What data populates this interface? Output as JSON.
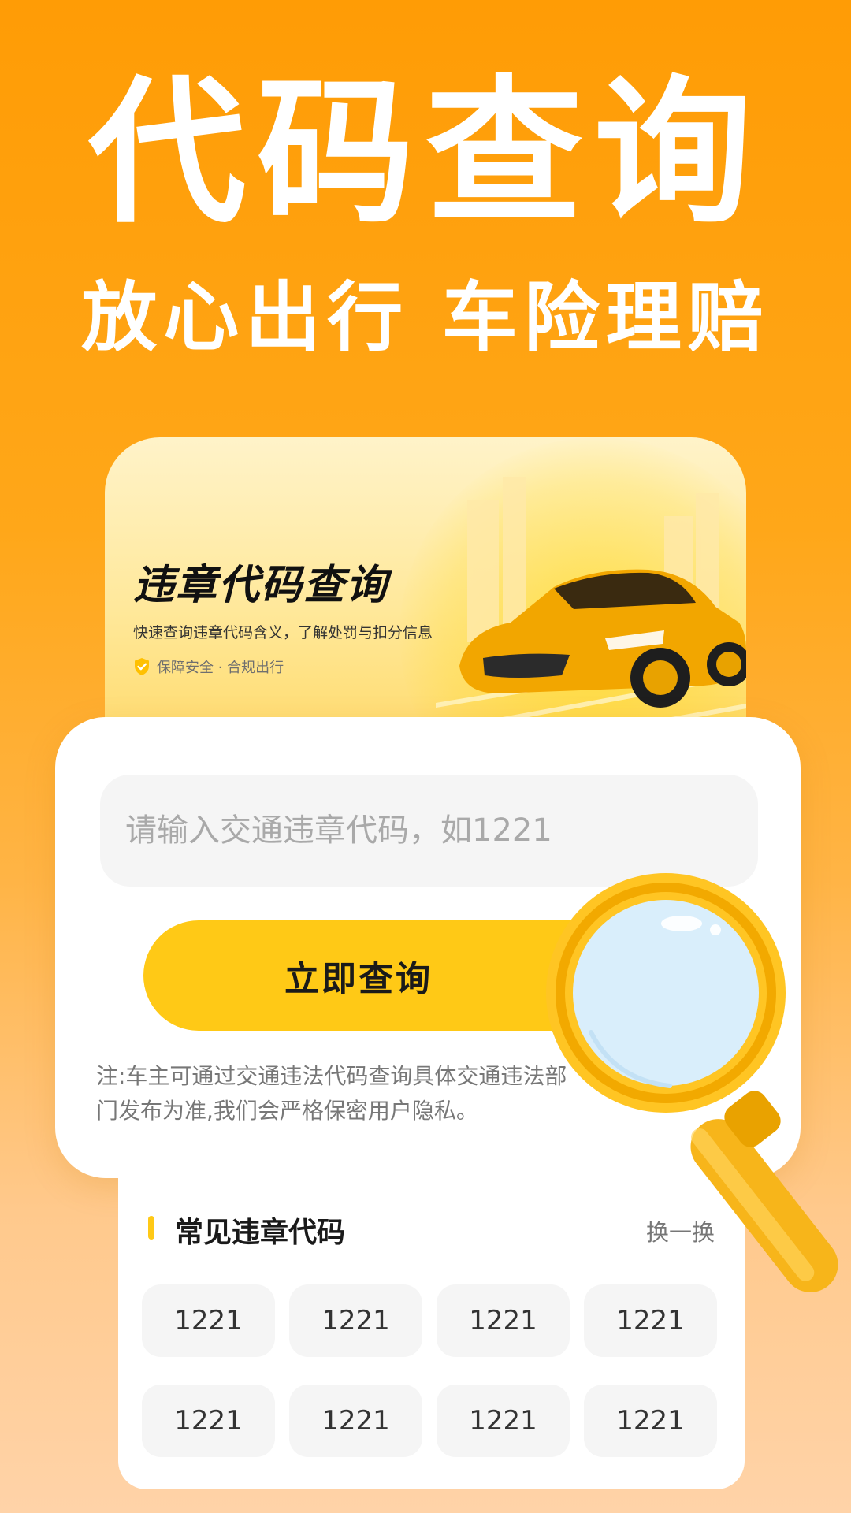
{
  "hero": {
    "title": "代码查询",
    "subtitle": "放心出行 车险理赔"
  },
  "banner": {
    "title": "违章代码查询",
    "description": "快速查询违章代码含义，了解处罚与扣分信息",
    "badge_text": "保障安全 · 合规出行"
  },
  "search": {
    "placeholder": "请输入交通违章代码，如1221",
    "button_label": "立即查询",
    "note": "注:车主可通过交通违法代码查询具体交通违法部门发布为准,我们会严格保密用户隐私。"
  },
  "common_codes": {
    "title": "常见违章代码",
    "refresh_label": "换一换",
    "codes": [
      "1221",
      "1221",
      "1221",
      "1221",
      "1221",
      "1221",
      "1221",
      "1221"
    ]
  },
  "colors": {
    "background_top": "#FF9C05",
    "accent_yellow": "#FFC916",
    "background_bottom": "#FFD3A8"
  }
}
